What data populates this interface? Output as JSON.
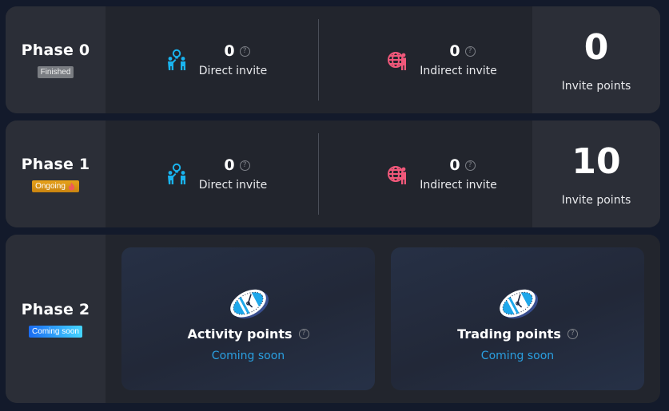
{
  "phases": [
    {
      "title": "Phase 0",
      "badge": "Finished",
      "direct_invite": {
        "count": "0",
        "label": "Direct invite"
      },
      "indirect_invite": {
        "count": "0",
        "label": "Indirect invite"
      },
      "invite_points": {
        "value": "0",
        "label": "Invite points"
      }
    },
    {
      "title": "Phase 1",
      "badge": "Ongoing",
      "direct_invite": {
        "count": "0",
        "label": "Direct invite"
      },
      "indirect_invite": {
        "count": "0",
        "label": "Indirect invite"
      },
      "invite_points": {
        "value": "10",
        "label": "Invite points"
      }
    },
    {
      "title": "Phase 2",
      "badge": "Coming soon",
      "cards": [
        {
          "title": "Activity points",
          "status": "Coming soon",
          "icon": "clock-icon"
        },
        {
          "title": "Trading points",
          "status": "Coming soon",
          "icon": "clock-icon"
        }
      ]
    }
  ],
  "icons": {
    "direct": "people-lightbulb-icon",
    "indirect": "globe-person-icon",
    "help": "?",
    "ongoing_badge_icon": "flame-icon"
  },
  "colors": {
    "direct_icon": "#19b4ef",
    "indirect_icon": "#f0587a",
    "coming_soon_text": "#2a9fe0",
    "finished_badge": "#7a7d82",
    "ongoing_badge": "#e0980f",
    "soon_badge_start": "#1a6cf2",
    "soon_badge_end": "#45d6ff"
  }
}
